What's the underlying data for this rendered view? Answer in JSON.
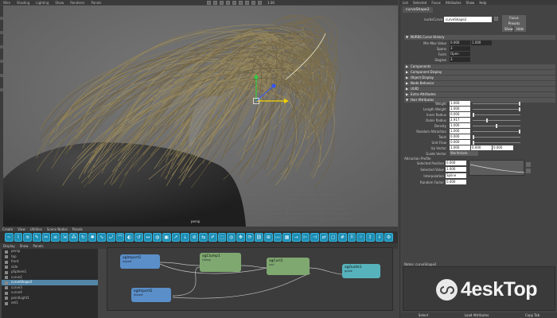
{
  "menubar": [
    "Wire",
    "Shading",
    "Lighting",
    "Show",
    "Renderer",
    "Panels"
  ],
  "status_value": "1.00",
  "viewport": {
    "camera": "persp"
  },
  "shelf_tabs": [
    "Create",
    "View",
    "Utilities",
    "Scene Nodes",
    "Panels"
  ],
  "shelf_icons": [
    "wave-icon",
    "curve-icon",
    "hair-icon",
    "brush-icon",
    "cut-icon",
    "comb-icon",
    "scale-icon",
    "clump-icon",
    "curl-icon",
    "frizz-icon",
    "noise-icon",
    "twist-icon",
    "bend-icon",
    "sculpt-icon",
    "loop-icon",
    "width-icon",
    "color-icon",
    "cache-icon",
    "grow-icon",
    "guide-icon",
    "lock-icon",
    "mirror-icon",
    "paint-icon",
    "select-icon",
    "tube-icon",
    "move-icon",
    "rotate-icon",
    "link-icon",
    "group-icon",
    "wire-icon",
    "ramp-icon",
    "extend-icon",
    "cut-end-icon",
    "trim-icon",
    "sync-icon",
    "frame-icon",
    "grid-icon",
    "density-icon",
    "spray-icon",
    "export-icon",
    "import-icon",
    "settings-icon"
  ],
  "shelf_glyphs": [
    "~",
    "⌇",
    "≋",
    "✎",
    "✂",
    "≡",
    "⇲",
    "⁂",
    "↻",
    "✱",
    "∿",
    "⤾",
    "⌒",
    "◐",
    "↺",
    "↔",
    "◍",
    "▣",
    "↗",
    "⇣",
    "⊘",
    "⇆",
    "✐",
    "⬚",
    "◎",
    "✥",
    "⟳",
    "⛓",
    "⊞",
    "〰",
    "▦",
    "→",
    "⊢",
    "⊣",
    "⇄",
    "▢",
    "#",
    "⠿",
    "⁘",
    "⇪",
    "⇩",
    "⚙"
  ],
  "outliner": {
    "menu": [
      "Display",
      "Show",
      "Panels"
    ],
    "rows": [
      {
        "label": "persp",
        "selected": false
      },
      {
        "label": "top",
        "selected": false
      },
      {
        "label": "front",
        "selected": false
      },
      {
        "label": "side",
        "selected": false
      },
      {
        "label": "pSphere1",
        "selected": false
      },
      {
        "label": "curve2",
        "selected": false
      },
      {
        "label": "curveShape2",
        "selected": true
      },
      {
        "label": "curve3",
        "selected": false
      },
      {
        "label": "curve4",
        "selected": false
      },
      {
        "label": "pointLight1",
        "selected": false
      },
      {
        "label": "set1",
        "selected": false
      }
    ]
  },
  "node_editor": {
    "nodes": [
      {
        "name": "xgImport1",
        "sub": "import",
        "color": "#5a8fc9"
      },
      {
        "name": "xgImport2",
        "sub": "import",
        "color": "#5a8fc9"
      },
      {
        "name": "xgClump1",
        "sub": "clump",
        "color": "#7fa870"
      },
      {
        "name": "xgCurl1",
        "sub": "curl",
        "color": "#7fa870"
      },
      {
        "name": "xgGuide1",
        "sub": "guide",
        "color": "#57b3bb"
      }
    ]
  },
  "attr_editor": {
    "menu": [
      "List",
      "Selected",
      "Focus",
      "Attributes",
      "Show",
      "Help"
    ],
    "tab": "curveShape2",
    "type_label": "nurbsCurve:",
    "shape_name": "curveShape2",
    "buttons": {
      "focus": "Focus",
      "presets": "Presets",
      "show": "Show",
      "hide": "Hide"
    },
    "sections": {
      "history": "NURBS Curve History",
      "components": "Components",
      "component_display": "Component Display",
      "object_display": "Object Display",
      "node_behavior": "Node Behavior",
      "uuid": "UUID",
      "extra": "Extra Attributes",
      "hair": "Hair Attributes"
    },
    "history_rows": [
      {
        "label": "Min Max Value",
        "value": "0.000",
        "value2": "1.000"
      },
      {
        "label": "Spans",
        "value": "3"
      },
      {
        "label": "Form",
        "value": "Open"
      },
      {
        "label": "Degree",
        "value": "3"
      }
    ],
    "hair_rows": [
      {
        "label": "Weight",
        "value": "1.000",
        "level": 1.0
      },
      {
        "label": "Length Weight",
        "value": "1.000",
        "level": 1.0
      },
      {
        "label": "Inner Radius",
        "value": "0.000",
        "level": 0.0
      },
      {
        "label": "Outer Radius",
        "value": "2.917",
        "level": 0.3
      },
      {
        "label": "Density",
        "value": "1.000",
        "level": 0.5
      },
      {
        "label": "Random Attraction",
        "value": "1.000",
        "level": 1.0
      },
      {
        "label": "Twist",
        "value": "0.000",
        "level": 0.0
      },
      {
        "label": "Unit Flow",
        "value": "0.000",
        "level": 0.0
      }
    ],
    "up_vector": {
      "label": "Up Vector",
      "x": "1.000",
      "y": "0.000",
      "z": "0.000"
    },
    "guide_vector": {
      "label": "Guide Vector",
      "value": "Worldstate"
    },
    "attraction_profile": "Attraction Profile",
    "profile_rows": [
      {
        "label": "Selected Position",
        "value": "0.000"
      },
      {
        "label": "Selected Value",
        "value": "1.000"
      },
      {
        "label": "Interpolation",
        "value": "Spline"
      },
      {
        "label": "Random Factor",
        "value": "0.000"
      }
    ],
    "notes": "Notes:  curveShape2",
    "bottom_buttons": [
      "Select",
      "Load Attributes",
      "Copy Tab"
    ]
  },
  "watermark": "4eskTop",
  "colors": {
    "accent_blue": "#1e8fb6",
    "selection": "#5285a6"
  }
}
